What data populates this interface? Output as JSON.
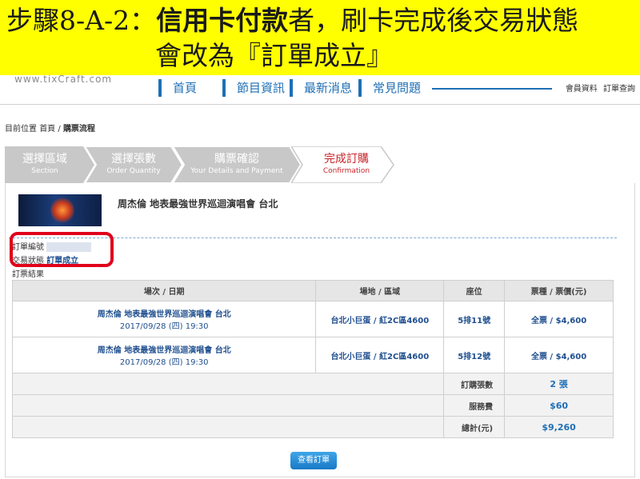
{
  "banner": {
    "step": "步驟8-A-2：",
    "bold_text": "信用卡付款",
    "line1_rest": "者，刷卡完成後交易狀態",
    "line2": "會改為『訂單成立』"
  },
  "site": {
    "logo": "www.tixCraft.com",
    "nav": [
      "首頁",
      "節目資訊",
      "最新消息",
      "常見問題"
    ],
    "user_links": [
      "會員資料",
      "訂單查詢"
    ]
  },
  "breadcrumb": {
    "prefix": "目前位置",
    "home": "首頁",
    "separator": "/",
    "current": "購票流程"
  },
  "steps": [
    {
      "label": "選擇區域",
      "sub": "Section"
    },
    {
      "label": "選擇張數",
      "sub": "Order Quantity"
    },
    {
      "label": "購票確認",
      "sub": "Your Details and Payment"
    },
    {
      "label": "完成訂購",
      "sub": "Confirmation"
    }
  ],
  "event": {
    "title": "周杰倫 地表最強世界巡迴演唱會 台北"
  },
  "order": {
    "number_label": "訂單編號",
    "status_label": "交易狀態",
    "status_value": "訂單成立",
    "result_label": "訂票結果"
  },
  "table": {
    "headers": [
      "場次 / 日期",
      "場地 / 區域",
      "座位",
      "票種 / 票價(元)"
    ],
    "rows": [
      {
        "event": "周杰倫 地表最強世界巡迴演唱會 台北",
        "date": "2017/09/28 (四) 19:30",
        "venue": "台北小巨蛋 / 紅2C區4600",
        "seat": "5排11號",
        "price": "全票 / $4,600"
      },
      {
        "event": "周杰倫 地表最強世界巡迴演唱會 台北",
        "date": "2017/09/28 (四) 19:30",
        "venue": "台北小巨蛋 / 紅2C區4600",
        "seat": "5排12號",
        "price": "全票 / $4,600"
      }
    ],
    "summary": [
      {
        "label": "訂購張數",
        "value": "2 張"
      },
      {
        "label": "服務費",
        "value": "$60"
      },
      {
        "label": "總計(元)",
        "value": "$9,260"
      }
    ]
  },
  "view_button": "查看訂單",
  "colors": {
    "banner": "#ffff00",
    "nav_blue": "#1f6fb5",
    "step_inactive": "#c8c8c8",
    "step_active_text": "#c9252c",
    "highlight": "#e0001b"
  }
}
